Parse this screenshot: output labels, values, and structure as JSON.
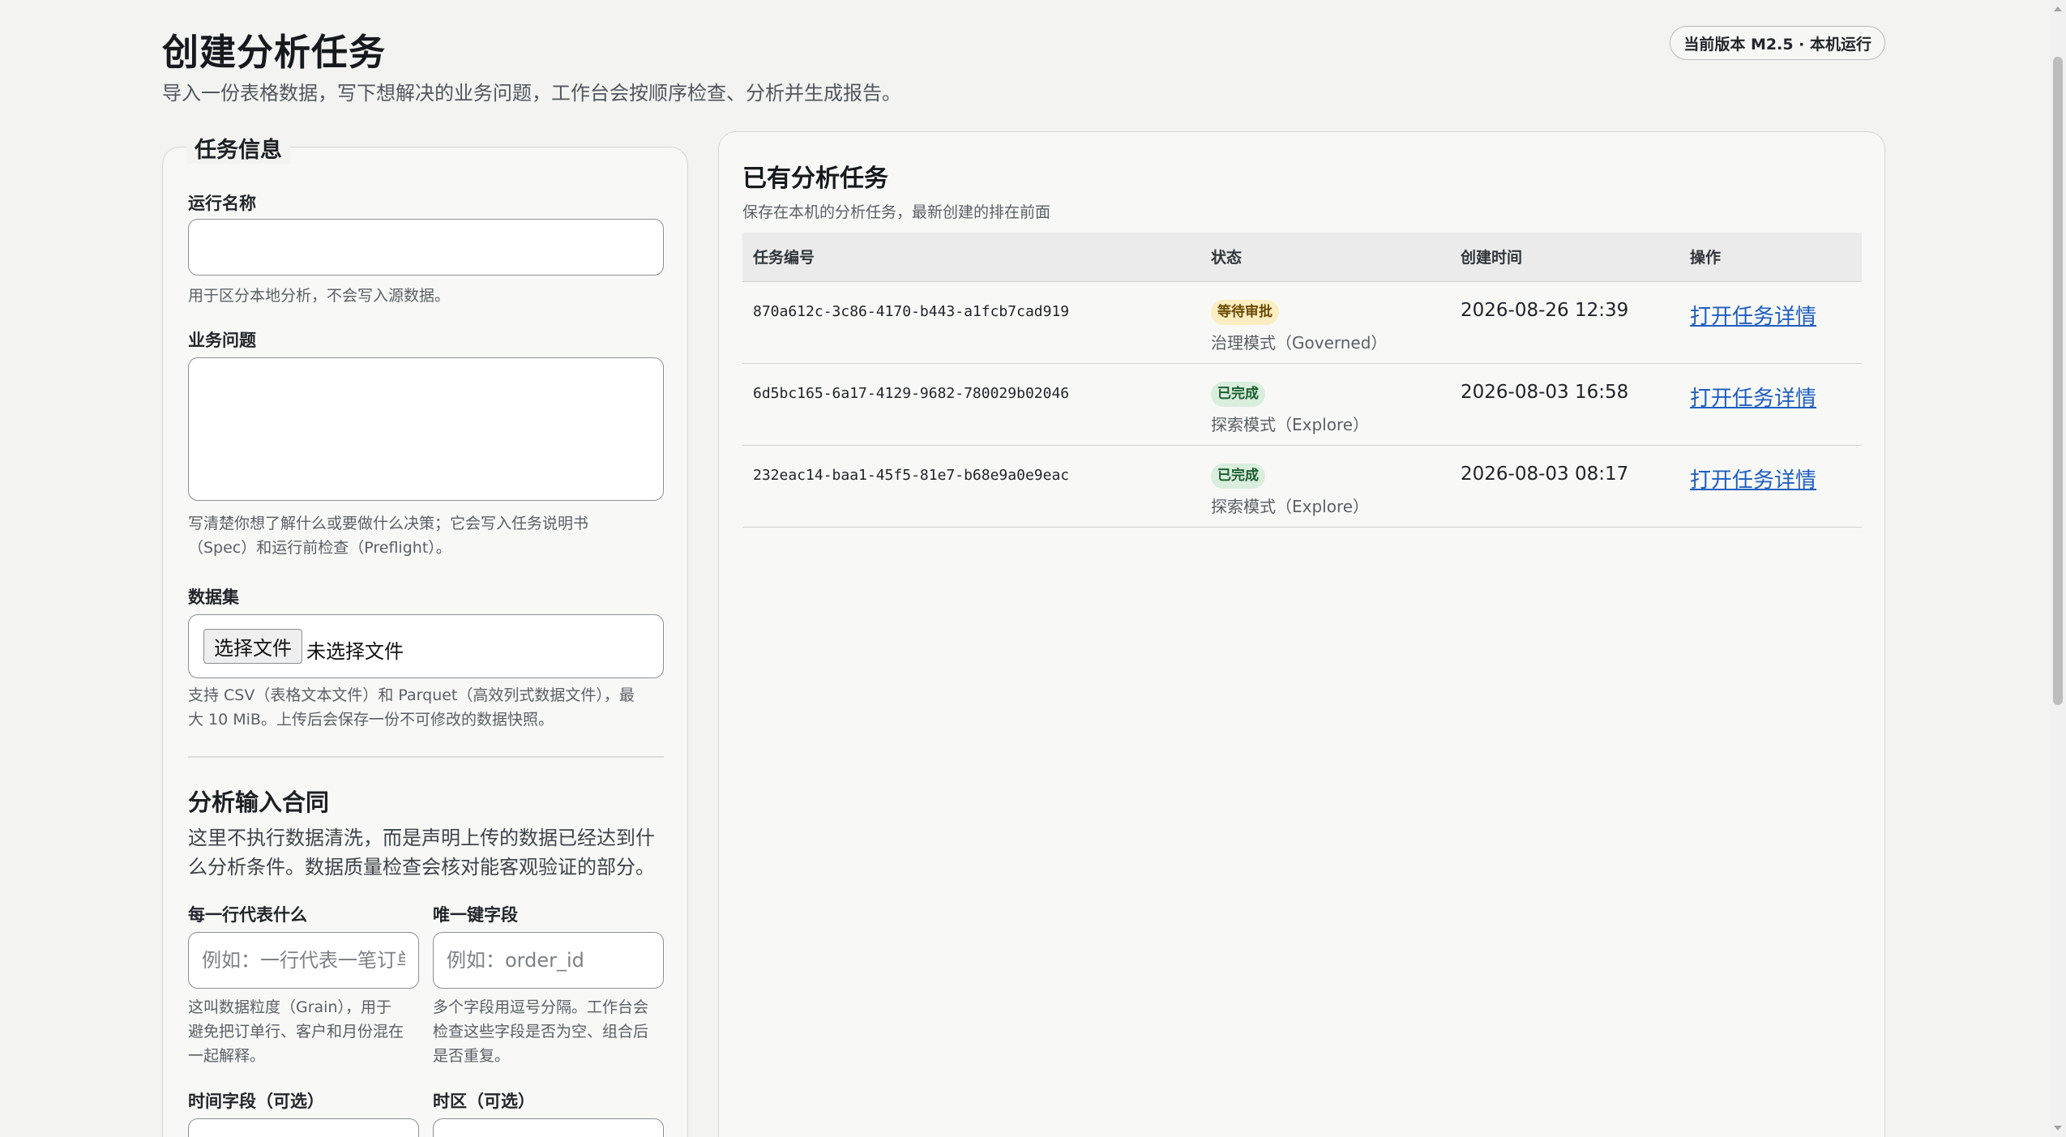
{
  "header": {
    "title": "创建分析任务",
    "subtitle": "导入一份表格数据，写下想解决的业务问题，工作台会按顺序检查、分析并生成报告。",
    "version_badge": "当前版本 M2.5 · 本机运行"
  },
  "form": {
    "legend": "任务信息",
    "run_name": {
      "label": "运行名称",
      "value": "",
      "hint": "用于区分本地分析，不会写入源数据。"
    },
    "question": {
      "label": "业务问题",
      "value": "",
      "hint_line1": "写清楚你想了解什么或要做什么决策；它会写入任务说明书",
      "hint_line2": "（Spec）和运行前检查（Preflight）。"
    },
    "dataset": {
      "label": "数据集",
      "button": "选择文件",
      "status": "未选择文件",
      "hint_line1": "支持 CSV（表格文本文件）和 Parquet（高效列式数据文件），最",
      "hint_line2": "大 10 MiB。上传后会保存一份不可修改的数据快照。"
    },
    "contract": {
      "title": "分析输入合同",
      "desc_line1": "这里不执行数据清洗，而是声明上传的数据已经达到什",
      "desc_line2": "么分析条件。数据质量检查会核对能客观验证的部分。",
      "grain": {
        "label": "每一行代表什么",
        "placeholder": "例如：一行代表一笔订单",
        "hint_line1": "这叫数据粒度（Grain），用于",
        "hint_line2": "避免把订单行、客户和月份混在",
        "hint_line3": "一起解释。"
      },
      "unique_key": {
        "label": "唯一键字段",
        "placeholder": "例如：order_id",
        "hint_line1": "多个字段用逗号分隔。工作台会",
        "hint_line2": "检查这些字段是否为空、组合后",
        "hint_line3": "是否重复。"
      },
      "time_field": {
        "label": "时间字段（可选）"
      },
      "timezone": {
        "label": "时区（可选）"
      }
    }
  },
  "tasks": {
    "title": "已有分析任务",
    "subtitle": "保存在本机的分析任务，最新创建的排在前面",
    "columns": [
      "任务编号",
      "状态",
      "创建时间",
      "操作"
    ],
    "rows": [
      {
        "id": "870a612c-3c86-4170-b443-a1fcb7cad919",
        "status": "等待审批",
        "mode": "治理模式（Governed）",
        "created": "2026-08-26 12:39",
        "action": "打开任务详情"
      },
      {
        "id": "6d5bc165-6a17-4129-9682-780029b02046",
        "status": "已完成",
        "mode": "探索模式（Explore）",
        "created": "2026-08-03 16:58",
        "action": "打开任务详情"
      },
      {
        "id": "232eac14-baa1-45f5-81e7-b68e9a0e9eac",
        "status": "已完成",
        "mode": "探索模式（Explore）",
        "created": "2026-08-03 08:17",
        "action": "打开任务详情"
      }
    ]
  },
  "colors": {
    "page_bg": "#f3f3f1",
    "link": "#1f5fbf",
    "badge_pending_bg": "#fbedc2",
    "badge_done_bg": "#d9eedd"
  }
}
